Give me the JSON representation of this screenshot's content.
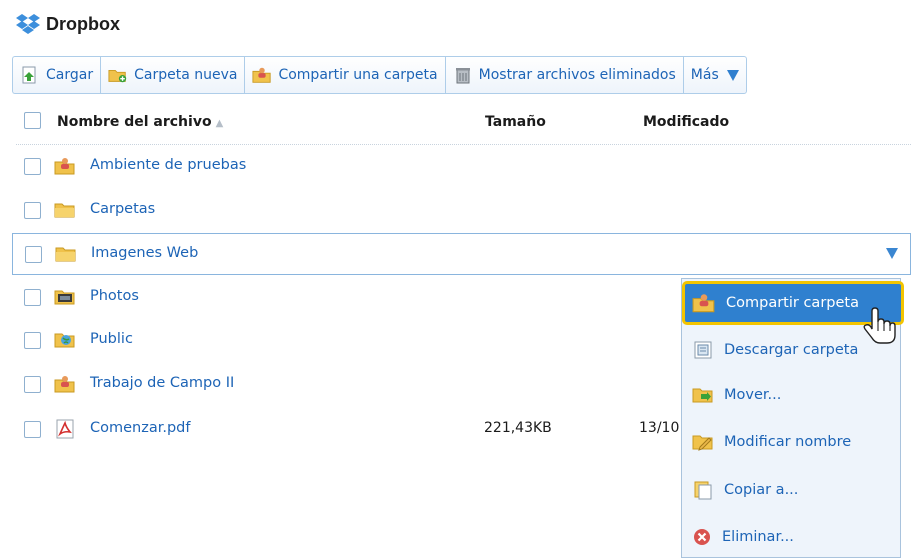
{
  "app": {
    "title": "Dropbox",
    "icon": "dropbox-logo-icon"
  },
  "toolbar": {
    "upload": "Cargar",
    "new_folder": "Carpeta nueva",
    "share_folder": "Compartir una carpeta",
    "show_deleted": "Mostrar archivos eliminados",
    "more": "Más"
  },
  "columns": {
    "name": "Nombre del archivo",
    "size": "Tamaño",
    "modified": "Modificado",
    "sort_indicator": "▲"
  },
  "files": [
    {
      "name": "Ambiente de pruebas",
      "icon": "shared-folder-icon",
      "size": "",
      "modified": ""
    },
    {
      "name": "Carpetas",
      "icon": "folder-icon",
      "size": "",
      "modified": ""
    },
    {
      "name": "Imagenes Web",
      "icon": "folder-icon",
      "size": "",
      "modified": "",
      "selected": true
    },
    {
      "name": "Photos",
      "icon": "photos-folder-icon",
      "size": "",
      "modified": ""
    },
    {
      "name": "Public",
      "icon": "public-folder-icon",
      "size": "",
      "modified": ""
    },
    {
      "name": "Trabajo de Campo II",
      "icon": "shared-folder-icon",
      "size": "",
      "modified": ""
    },
    {
      "name": "Comenzar.pdf",
      "icon": "pdf-file-icon",
      "size": "221,43KB",
      "modified": "13/10"
    }
  ],
  "context_menu": [
    {
      "label": "Compartir carpeta",
      "icon": "share-folder-icon",
      "active": true
    },
    {
      "label": "Descargar carpeta",
      "icon": "download-icon"
    },
    {
      "label": "Mover...",
      "icon": "move-icon"
    },
    {
      "label": "Modificar nombre",
      "icon": "rename-icon"
    },
    {
      "label": "Copiar a...",
      "icon": "copy-icon"
    },
    {
      "label": "Eliminar...",
      "icon": "delete-icon"
    }
  ],
  "colors": {
    "link": "#1d64b6",
    "highlight": "#2f80cf",
    "focus_border": "#f3c400",
    "menu_bg": "#eef4fb"
  }
}
